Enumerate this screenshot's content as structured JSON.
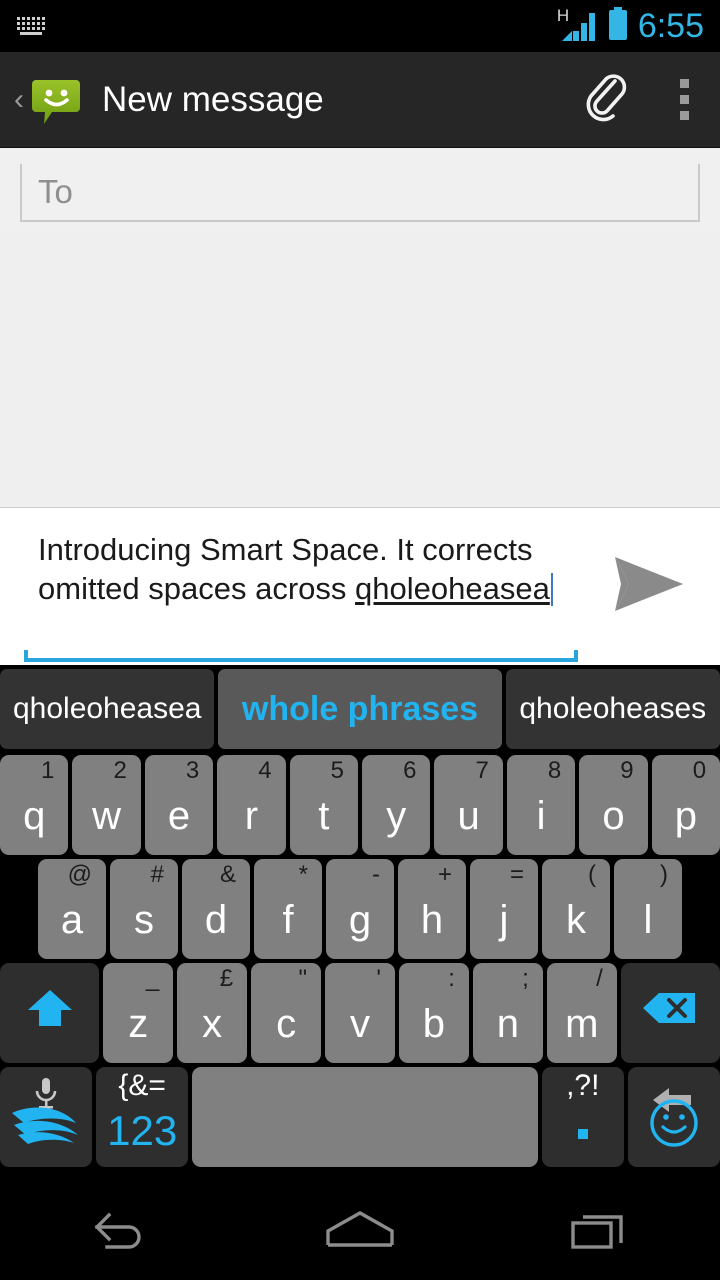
{
  "status_bar": {
    "keyboard_icon": "keyboard-icon",
    "network_type": "H",
    "signal_icon": "signal-bars-icon",
    "battery_icon": "battery-icon",
    "time": "6:55",
    "accent_color": "#33b5e5"
  },
  "action_bar": {
    "up_chevron": "‹",
    "app_icon": "messaging-app-icon",
    "title": "New message",
    "attach_icon": "paperclip-icon",
    "overflow_icon": "overflow-menu-icon",
    "background_color": "#262626"
  },
  "compose": {
    "to_placeholder": "To",
    "to_value": "",
    "message_text_plain": "Introducing Smart Space. It corrects omitted spaces across ",
    "message_text_composing": "qholeoheasea",
    "send_icon": "send-paper-plane-icon",
    "field_underline_color": "#29a4dd"
  },
  "keyboard": {
    "suggestions": [
      {
        "label": "qholeoheasea",
        "selected": false
      },
      {
        "label": "whole phrases",
        "selected": true
      },
      {
        "label": "qholeoheases",
        "selected": false
      }
    ],
    "suggestion_highlight_color": "#22b4f0",
    "rows": {
      "row1": [
        {
          "main": "q",
          "alt": "1"
        },
        {
          "main": "w",
          "alt": "2"
        },
        {
          "main": "e",
          "alt": "3"
        },
        {
          "main": "r",
          "alt": "4"
        },
        {
          "main": "t",
          "alt": "5"
        },
        {
          "main": "y",
          "alt": "6"
        },
        {
          "main": "u",
          "alt": "7"
        },
        {
          "main": "i",
          "alt": "8"
        },
        {
          "main": "o",
          "alt": "9"
        },
        {
          "main": "p",
          "alt": "0"
        }
      ],
      "row2": [
        {
          "main": "a",
          "alt": "@"
        },
        {
          "main": "s",
          "alt": "#"
        },
        {
          "main": "d",
          "alt": "&"
        },
        {
          "main": "f",
          "alt": "*"
        },
        {
          "main": "g",
          "alt": "-"
        },
        {
          "main": "h",
          "alt": "+"
        },
        {
          "main": "j",
          "alt": "="
        },
        {
          "main": "k",
          "alt": "("
        },
        {
          "main": "l",
          "alt": ")"
        }
      ],
      "row3": [
        {
          "main": "z",
          "alt": "_"
        },
        {
          "main": "x",
          "alt": "£"
        },
        {
          "main": "c",
          "alt": "\""
        },
        {
          "main": "v",
          "alt": "'"
        },
        {
          "main": "b",
          "alt": ":"
        },
        {
          "main": "n",
          "alt": ";"
        },
        {
          "main": "m",
          "alt": "/"
        }
      ],
      "shift_key": "shift-key",
      "backspace_key": "backspace-key",
      "swiftkey_key": "swiftkey-logo-key",
      "mic_icon": "microphone-icon",
      "symbols_alt": "{&=",
      "symbols_main": "123",
      "space_key": "space-key",
      "period_alt": ",?!",
      "period_main": ".",
      "enter_icon": "enter-key-icon",
      "emoji_icon": "emoji-smiley-icon"
    }
  },
  "nav_bar": {
    "back": "back-nav-icon",
    "home": "home-nav-icon",
    "recents": "recents-nav-icon"
  }
}
